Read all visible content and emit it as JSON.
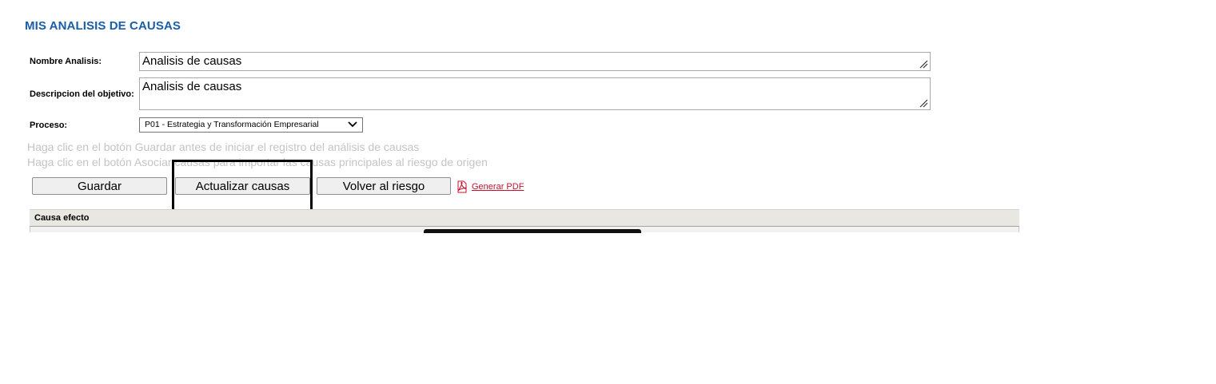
{
  "page": {
    "title": "MIS ANALISIS DE CAUSAS"
  },
  "form": {
    "nombre_label": "Nombre Analisis:",
    "nombre_value": "Analisis de causas",
    "descripcion_label": "Descripcion del objetivo:",
    "descripcion_value": "Analisis de causas",
    "proceso_label": "Proceso:",
    "proceso_selected": "P01 - Estrategia y Transformación Empresarial"
  },
  "hints": {
    "line1": "Haga clic en el botón Guardar antes de iniciar el registro del análisis de causas",
    "line2": "Haga clic en el botón Asociar causas para importar las causas principales al riesgo de origen"
  },
  "toolbar": {
    "guardar_label": "Guardar",
    "actualizar_label": "Actualizar causas",
    "volver_label": "Volver al riesgo",
    "pdf_label": "Generar PDF",
    "pdf_icon": "pdf-icon"
  },
  "grid": {
    "header": "Causa efecto"
  },
  "colors": {
    "title": "#1a5ea8",
    "hint": "#c4c4c4",
    "pdf_link": "#c8102e",
    "grid_header_bg": "#e9e7e2"
  }
}
